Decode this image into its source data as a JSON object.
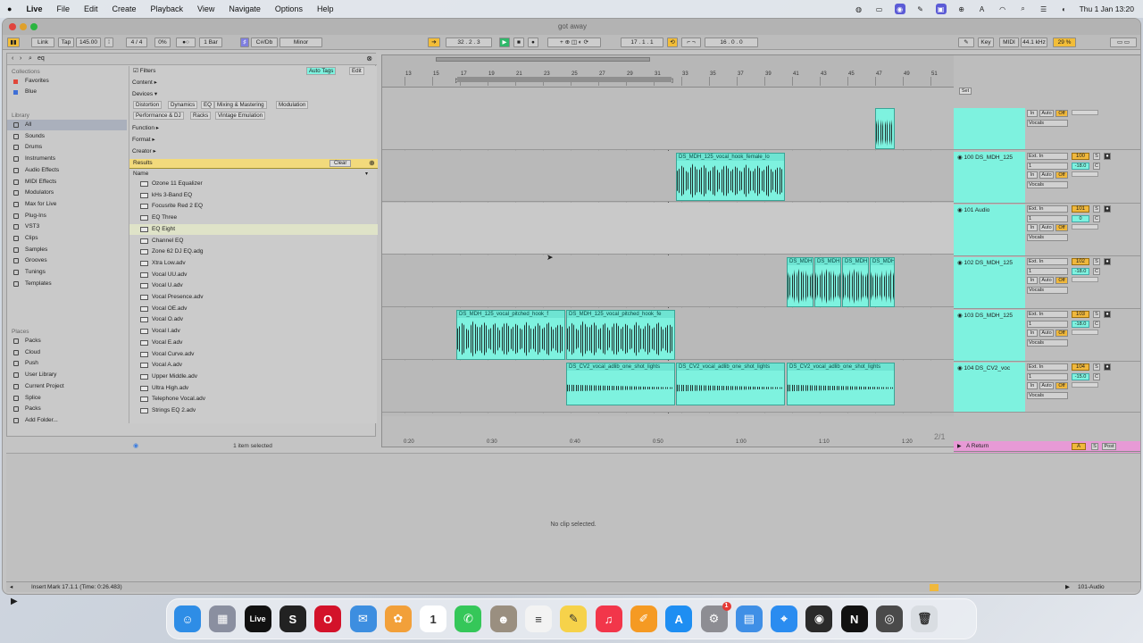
{
  "menubar": {
    "items": [
      "Live",
      "File",
      "Edit",
      "Create",
      "Playback",
      "View",
      "Navigate",
      "Options",
      "Help"
    ],
    "clock": "Thu 1 Jan  13:20"
  },
  "window": {
    "title": "got away"
  },
  "control": {
    "link": "Link",
    "tap": "Tap",
    "tempo": "145.00",
    "signature": "4 / 4",
    "swing": "0%",
    "quantize": "1 Bar",
    "key": "C#/Db",
    "scale": "Minor",
    "position": "32 .  2 .  3",
    "loop_start": "17 .  1 .  1",
    "loop_length": "16 .  0 .  0",
    "key_label": "Key",
    "midi_label": "MIDI",
    "sample_rate": "44.1 kHz",
    "cpu": "29 %"
  },
  "browser": {
    "search_value": "eq",
    "collections_title": "Collections",
    "collections": [
      {
        "label": "Favorites",
        "color": "#e0473a"
      },
      {
        "label": "Blue",
        "color": "#3f6fd6"
      }
    ],
    "library_title": "Library",
    "library": [
      "All",
      "Sounds",
      "Drums",
      "Instruments",
      "Audio Effects",
      "MIDI Effects",
      "Modulators",
      "Max for Live",
      "Plug-Ins",
      "VST3",
      "Clips",
      "Samples",
      "Grooves",
      "Tunings",
      "Templates"
    ],
    "places_title": "Places",
    "places": [
      "Packs",
      "Cloud",
      "Push",
      "User Library",
      "Current Project",
      "Splice",
      "Packs",
      "Add Folder..."
    ],
    "filters_label": "Filters",
    "auto_tags": "Auto Tags",
    "edit": "Edit",
    "content": "Content",
    "devices": "Devices",
    "device_tags": [
      "Distortion",
      "Dynamics",
      "EQ",
      "Mixing & Mastering",
      "Modulation",
      "Performance & DJ",
      "Racks",
      "Vintage Emulation"
    ],
    "function": "Function",
    "format": "Format",
    "creator": "Creator",
    "results": "Results",
    "clear": "Clear",
    "name_col": "Name",
    "items": [
      "Ozone 11 Equalizer",
      "kHs 3-Band EQ",
      "Focusrite Red 2 EQ",
      "EQ Three",
      "EQ Eight",
      "Channel EQ",
      "Zone 62 DJ EQ.adg",
      "Xtra Low.adv",
      "Vocal UU.adv",
      "Vocal U.adv",
      "Vocal Presence.adv",
      "Vocal OE.adv",
      "Vocal O.adv",
      "Vocal I.adv",
      "Vocal E.adv",
      "Vocal Curve.adv",
      "Vocal A.adv",
      "Upper Middle.adv",
      "Ultra High.adv",
      "Telephone Vocal.adv",
      "Strings EQ 2.adv"
    ],
    "selected_index": 4,
    "status": "1 item selected"
  },
  "ruler": {
    "bars": [
      "13",
      "15",
      "17",
      "19",
      "21",
      "23",
      "25",
      "27",
      "29",
      "31",
      "33",
      "35",
      "37",
      "39",
      "41",
      "43",
      "45",
      "47",
      "49",
      "51"
    ]
  },
  "timeaxis": [
    "0:20",
    "0:30",
    "0:40",
    "0:50",
    "1:00",
    "1:10",
    "1:20"
  ],
  "clips": {
    "female": "DS_MDH_125_vocal_hook_female_lo",
    "c102a": "DS_MDH",
    "c102b": "DS_MDH",
    "c102c": "DS_MDH",
    "c102d": "DS_MDH",
    "pitched1": "DS_MDH_125_vocal_pitched_hook_f",
    "pitched2": "DS_MDH_125_vocal_pitched_hook_fe",
    "adlib1": "DS_CV2_vocal_adlib_one_shot_lights",
    "adlib2": "DS_CV2_vocal_adlib_one_shot_lights",
    "adlib3": "DS_CV2_vocal_adlib_one_shot_lights"
  },
  "tracks": [
    {
      "name": "",
      "num": "",
      "vol": "",
      "top_only": true
    },
    {
      "name": "100 DS_MDH_125",
      "num": "100",
      "vol": "-18.0"
    },
    {
      "name": "101 Audio",
      "num": "101",
      "vol": "0"
    },
    {
      "name": "102 DS_MDH_125",
      "num": "102",
      "vol": "-18.0"
    },
    {
      "name": "103 DS_MDH_125",
      "num": "103",
      "vol": "-18.0"
    },
    {
      "name": "104 DS_CV2_voc",
      "num": "104",
      "vol": "-15.0"
    }
  ],
  "mixer_labels": {
    "ext_in": "Ext. In",
    "in": "In",
    "auto": "Auto",
    "off": "Off",
    "vocals": "Vocals",
    "s": "S",
    "c": "C",
    "one": "1",
    "set": "Set"
  },
  "returns": [
    {
      "name": "A Return",
      "letter": "A"
    },
    {
      "name": "B Return",
      "letter": "B"
    },
    {
      "name": "Main",
      "letter": ""
    }
  ],
  "post": "Post",
  "page_counter": "2/1",
  "main_output": "1/2",
  "detail": {
    "empty": "No clip selected."
  },
  "statusbar": {
    "text": "Insert Mark 17.1.1 (Time: 0:26.483)",
    "track": "101-Audio"
  },
  "dock": [
    {
      "name": "finder",
      "label": "☺",
      "color": "#2e8de6"
    },
    {
      "name": "launchpad",
      "label": "▦",
      "color": "#8a8fa0"
    },
    {
      "name": "ableton-live",
      "label": "Live",
      "color": "#111"
    },
    {
      "name": "splice",
      "label": "S",
      "color": "#222"
    },
    {
      "name": "opera",
      "label": "O",
      "color": "#d3122a"
    },
    {
      "name": "mail",
      "label": "✉",
      "color": "#3d8ee0"
    },
    {
      "name": "photos",
      "label": "✿",
      "color": "#f2a03a"
    },
    {
      "name": "calendar",
      "label": "1",
      "color": "#ffffff"
    },
    {
      "name": "messages",
      "label": "✆",
      "color": "#35c759"
    },
    {
      "name": "contacts",
      "label": "☻",
      "color": "#9a8f80"
    },
    {
      "name": "reminders",
      "label": "≡",
      "color": "#f3f3f3"
    },
    {
      "name": "notes",
      "label": "✎",
      "color": "#f6d24a"
    },
    {
      "name": "music",
      "label": "♫",
      "color": "#f2364a"
    },
    {
      "name": "pages",
      "label": "✐",
      "color": "#f59a23"
    },
    {
      "name": "app-store",
      "label": "A",
      "color": "#1e8ef2"
    },
    {
      "name": "system-settings",
      "label": "⚙",
      "color": "#8d8d93"
    },
    {
      "name": "preview",
      "label": "▤",
      "color": "#3f8fe6"
    },
    {
      "name": "safari",
      "label": "⌖",
      "color": "#2a8cf0"
    },
    {
      "name": "obs",
      "label": "◉",
      "color": "#2a2a2a"
    },
    {
      "name": "capcut",
      "label": "N",
      "color": "#111"
    },
    {
      "name": "unknown-app",
      "label": "◎",
      "color": "#4a4a4a"
    },
    {
      "name": "trash",
      "label": "🗑",
      "color": "#d9dde2"
    }
  ],
  "dock_badge": "1"
}
